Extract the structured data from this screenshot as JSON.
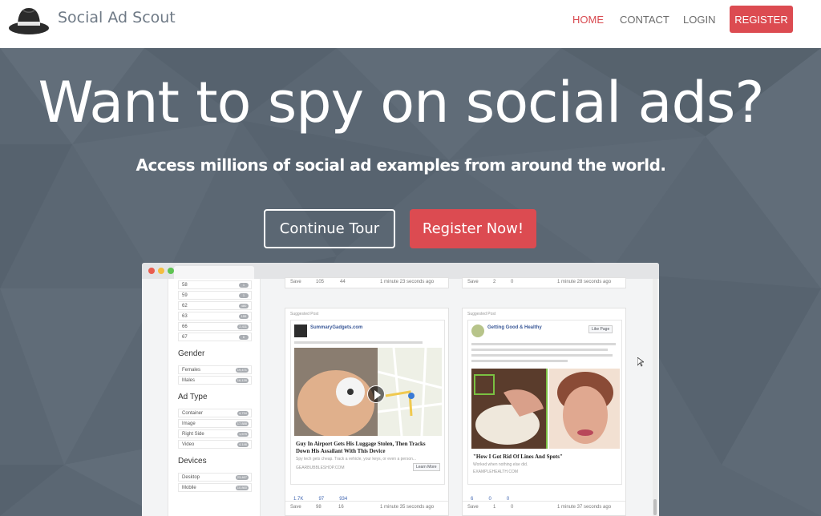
{
  "nav": {
    "brand": "Social Ad Scout",
    "links": [
      "HOME",
      "CONTACT",
      "LOGIN"
    ],
    "register": "REGISTER",
    "accent": "#dc4b51"
  },
  "hero": {
    "headline": "Want to spy on social ads?",
    "subline": "Access millions of social ad examples from around the world.",
    "btn_tour": "Continue Tour",
    "btn_register": "Register Now!"
  },
  "preview": {
    "ages": [
      {
        "label": "58",
        "count": "1"
      },
      {
        "label": "59",
        "count": "1"
      },
      {
        "label": "62",
        "count": "480"
      },
      {
        "label": "63",
        "count": "155"
      },
      {
        "label": "66",
        "count": "2,411"
      },
      {
        "label": "67",
        "count": "6"
      }
    ],
    "gender_title": "Gender",
    "gender": [
      {
        "label": "Females",
        "count": "19,471"
      },
      {
        "label": "Males",
        "count": "16,139"
      }
    ],
    "adtype_title": "Ad Type",
    "adtype": [
      {
        "label": "Container",
        "count": "4,734"
      },
      {
        "label": "Image",
        "count": "17,888"
      },
      {
        "label": "Right Side",
        "count": "1,575"
      },
      {
        "label": "Video",
        "count": "4,146"
      }
    ],
    "devices_title": "Devices",
    "devices": [
      {
        "label": "Desktop",
        "count": "23,467"
      },
      {
        "label": "Mobile",
        "count": "10,860"
      }
    ],
    "top_row": {
      "c1_save": "Save",
      "c1_views": "105",
      "c1_days": "44",
      "c1_time": "1 minute 23 seconds ago",
      "c2_save": "Save",
      "c2_views": "2",
      "c2_days": "0",
      "c2_time": "1 minute 28 seconds ago"
    },
    "card1": {
      "tag": "Suggested Post",
      "page": "SummaryGadgets.com",
      "caption": "Guy In Airport Gets His Luggage Stolen, Then Tracks Down His Assailant With This Device",
      "desc": "Spy tech gets cheap. Track a vehicle, your keys, or even a person...",
      "domain": "GEARBUBBLESHOP.COM",
      "cta": "Learn More",
      "likes": "1.7K",
      "comments": "97",
      "shares": "934",
      "save": "Save",
      "views": "98",
      "days": "16",
      "time": "1 minute 35 seconds ago"
    },
    "card2": {
      "tag": "Suggested Post",
      "page": "Getting Good & Healthy",
      "like_page": "Like Page",
      "caption": "\"How I Got Rid Of Lines And Spots\"",
      "desc": "Worked when nothing else did.",
      "domain": "EXAMPLEHEALTH.COM",
      "likes": "6",
      "comments": "0",
      "shares": "0",
      "save": "Save",
      "views": "1",
      "days": "0",
      "time": "1 minute 37 seconds ago"
    }
  }
}
